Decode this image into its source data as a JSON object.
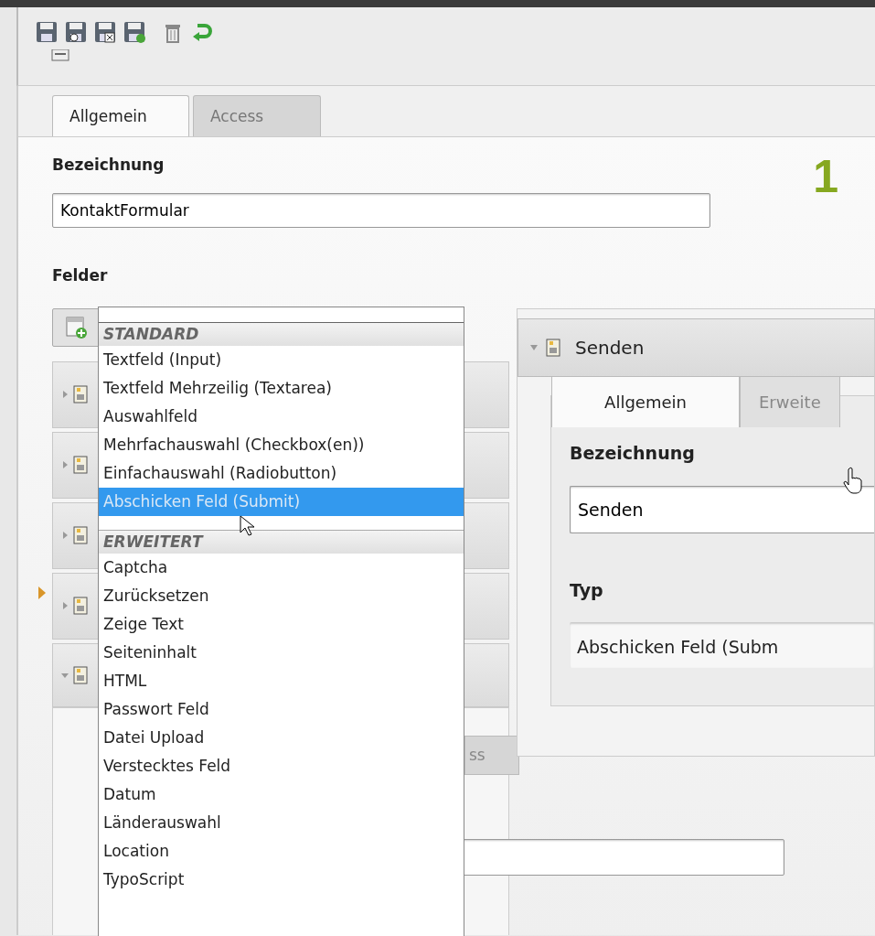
{
  "toolbar": {
    "buttons": [
      {
        "kind": "save"
      },
      {
        "kind": "save-view"
      },
      {
        "kind": "save-close"
      },
      {
        "kind": "save-new"
      },
      {
        "kind": "delete"
      },
      {
        "kind": "undo"
      }
    ]
  },
  "tabs": [
    {
      "label": "Allgemein",
      "selected": true
    },
    {
      "label": "Access",
      "selected": false
    }
  ],
  "step_number": "1",
  "name_label": "Bezeichnung",
  "name_value": "KontaktFormular",
  "fields_label": "Felder",
  "element_rows": [
    {
      "expanded": false,
      "marked": false
    },
    {
      "expanded": false,
      "marked": false
    },
    {
      "expanded": false,
      "marked": false
    },
    {
      "expanded": false,
      "marked": true
    },
    {
      "expanded": true,
      "marked": false
    }
  ],
  "lower_tab_fragment": "ss",
  "dropdown": {
    "groups": [
      {
        "heading": "STANDARD",
        "items": [
          {
            "label": "Textfeld (Input)",
            "selected": false
          },
          {
            "label": "Textfeld Mehrzeilig (Textarea)",
            "selected": false
          },
          {
            "label": "Auswahlfeld",
            "selected": false
          },
          {
            "label": "Mehrfachauswahl (Checkbox(en))",
            "selected": false
          },
          {
            "label": "Einfachauswahl (Radiobutton)",
            "selected": false
          },
          {
            "label": "Abschicken Feld (Submit)",
            "selected": true
          }
        ]
      },
      {
        "heading": "ERWEITERT",
        "items": [
          {
            "label": "Captcha",
            "selected": false
          },
          {
            "label": "Zurücksetzen",
            "selected": false
          },
          {
            "label": "Zeige Text",
            "selected": false
          },
          {
            "label": "Seiteninhalt",
            "selected": false
          },
          {
            "label": "HTML",
            "selected": false
          },
          {
            "label": "Passwort Feld",
            "selected": false
          },
          {
            "label": "Datei Upload",
            "selected": false
          },
          {
            "label": "Verstecktes Feld",
            "selected": false
          },
          {
            "label": "Datum",
            "selected": false
          },
          {
            "label": "Länderauswahl",
            "selected": false
          },
          {
            "label": "Location",
            "selected": false
          },
          {
            "label": "TypoScript",
            "selected": false
          }
        ]
      }
    ]
  },
  "detail": {
    "title": "Senden",
    "expanded": true,
    "tabs": [
      {
        "label": "Allgemein",
        "selected": true
      },
      {
        "label": "Erweite",
        "selected": false
      }
    ],
    "name_label": "Bezeichnung",
    "name_value": "Senden",
    "type_label": "Typ",
    "type_value": "Abschicken Feld (Subm"
  }
}
